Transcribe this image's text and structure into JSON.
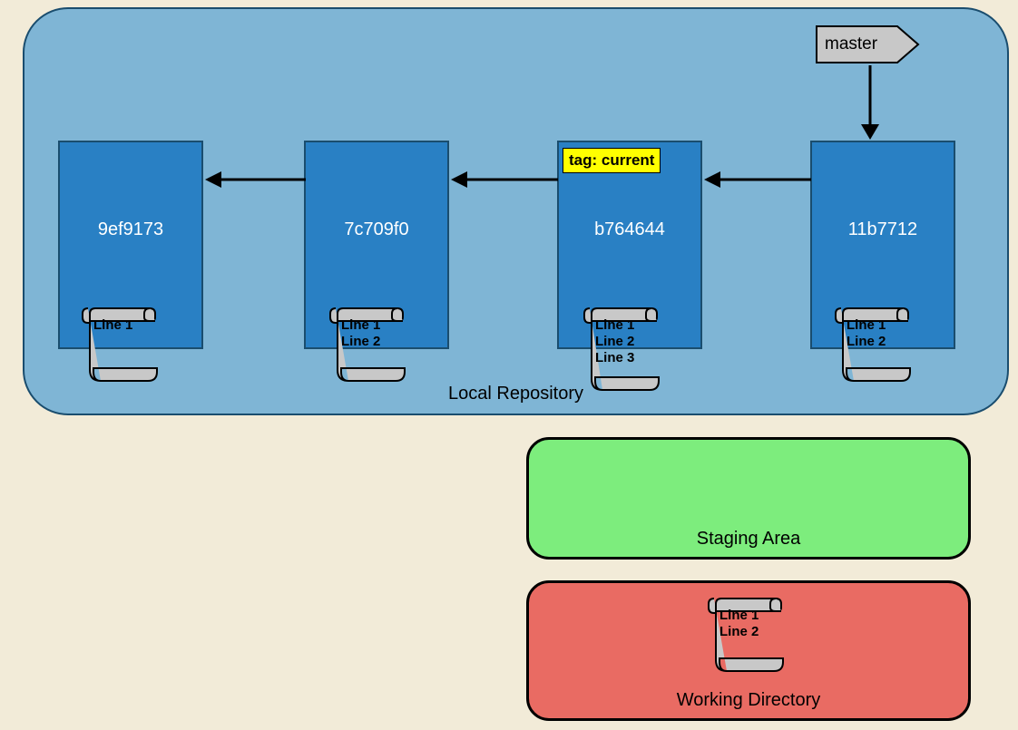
{
  "repo": {
    "label": "Local Repository",
    "master_label": "master",
    "commits": [
      {
        "hash": "9ef9173",
        "lines": "Line 1"
      },
      {
        "hash": "7c709f0",
        "lines": "Line 1\nLine 2"
      },
      {
        "hash": "b764644",
        "lines": "Line 1\nLine 2\nLine 3",
        "tag": "tag: current"
      },
      {
        "hash": "11b7712",
        "lines": "Line 1\nLine 2"
      }
    ]
  },
  "staging": {
    "label": "Staging Area"
  },
  "working": {
    "label": "Working Directory",
    "lines": "Line 1\nLine 2"
  }
}
